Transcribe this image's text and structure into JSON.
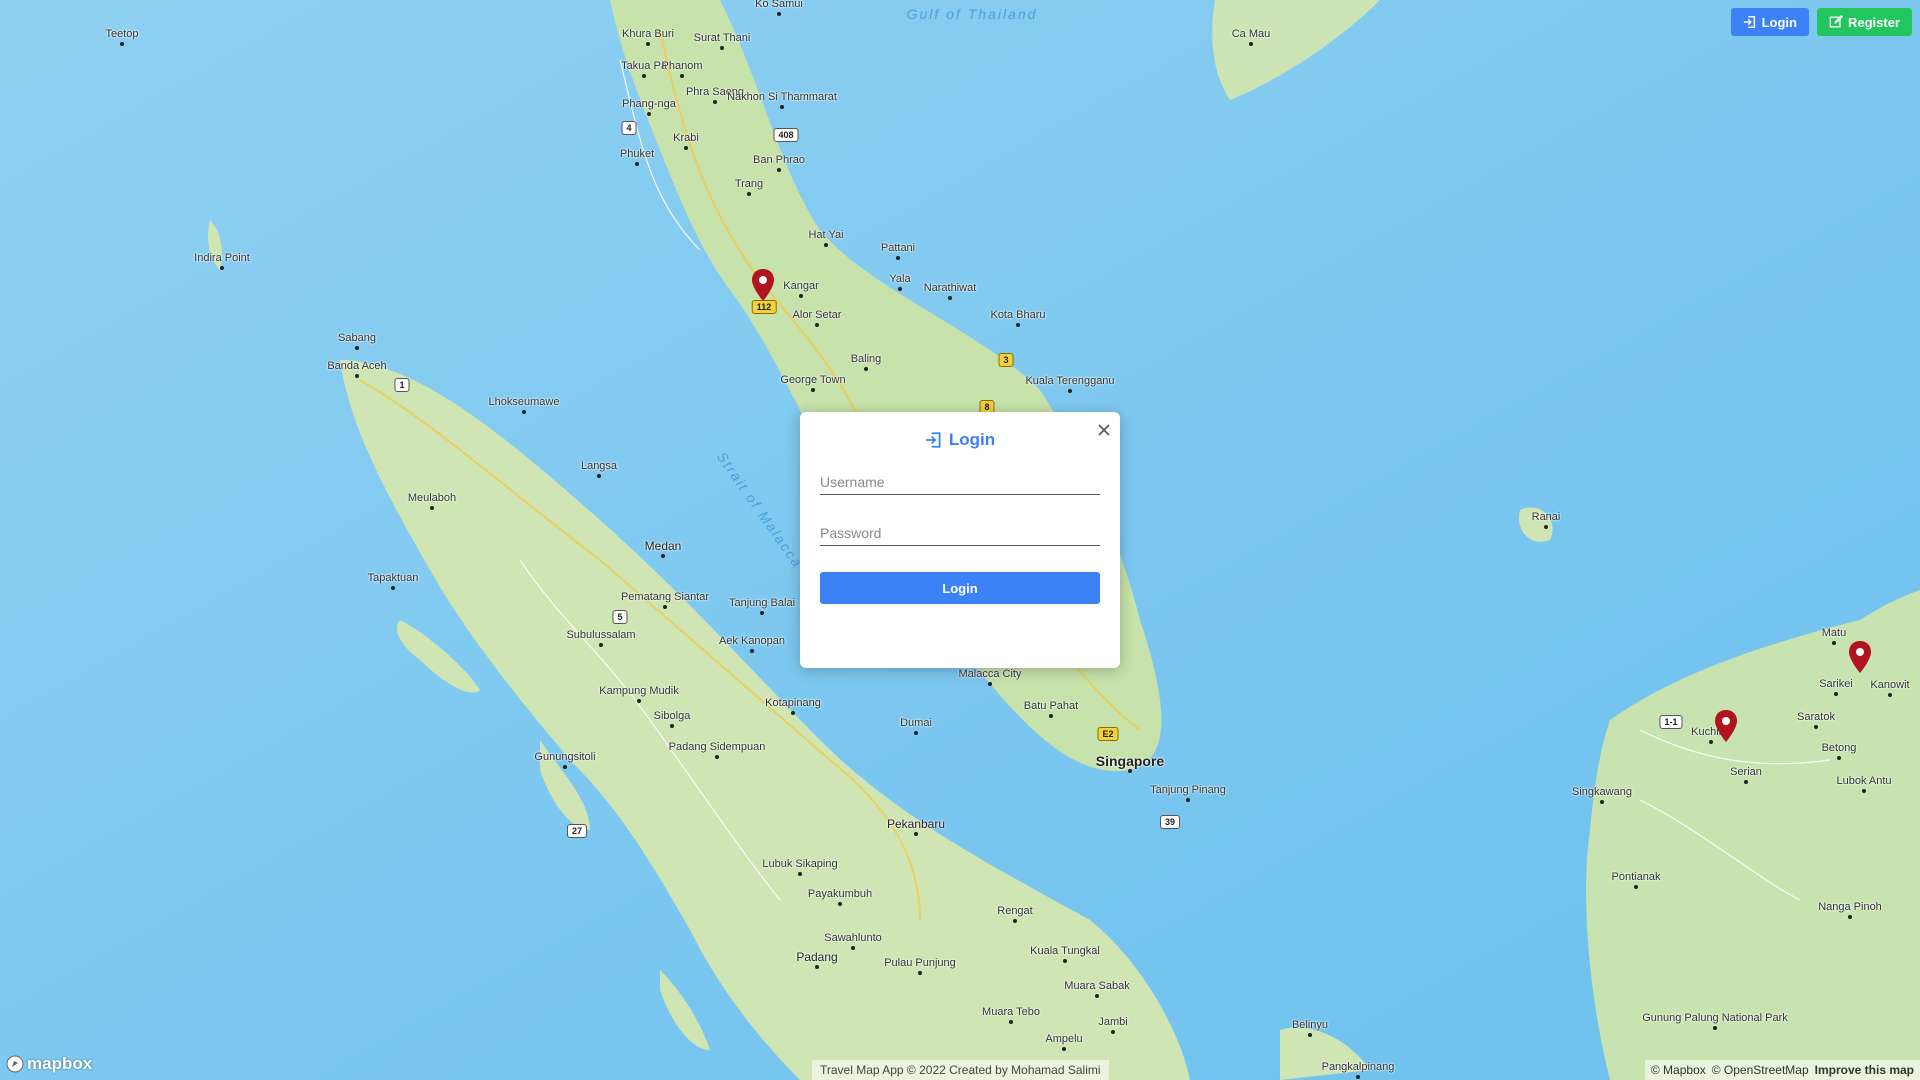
{
  "header": {
    "login_label": "Login",
    "register_label": "Register"
  },
  "modal": {
    "title": "Login",
    "username_placeholder": "Username",
    "password_placeholder": "Password",
    "submit_label": "Login"
  },
  "map": {
    "places": [
      {
        "name": "Teetop",
        "size": "small"
      },
      {
        "name": "Indira Point",
        "size": "small"
      },
      {
        "name": "Sabang",
        "size": "small"
      },
      {
        "name": "Banda Aceh",
        "size": "small"
      },
      {
        "name": "Lhokseumawe",
        "size": "small"
      },
      {
        "name": "Langsa",
        "size": "small"
      },
      {
        "name": "Meulaboh",
        "size": "small"
      },
      {
        "name": "Medan",
        "size": "med"
      },
      {
        "name": "Pematang Siantar",
        "size": "small"
      },
      {
        "name": "Tanjung Balai",
        "size": "small"
      },
      {
        "name": "Tapaktuan",
        "size": "small"
      },
      {
        "name": "Subulussalam",
        "size": "small"
      },
      {
        "name": "Aek Kanopan",
        "size": "small"
      },
      {
        "name": "Kampung Mudik",
        "size": "small"
      },
      {
        "name": "Sibolga",
        "size": "small"
      },
      {
        "name": "Padang Sidempuan",
        "size": "small"
      },
      {
        "name": "Kotapinang",
        "size": "small"
      },
      {
        "name": "Gunungsitoli",
        "size": "small"
      },
      {
        "name": "Lubuk Sikaping",
        "size": "small"
      },
      {
        "name": "Payakumbuh",
        "size": "small"
      },
      {
        "name": "Sawahlunto",
        "size": "small"
      },
      {
        "name": "Padang",
        "size": "med"
      },
      {
        "name": "Pulau Punjung",
        "size": "small"
      },
      {
        "name": "Pekanbaru",
        "size": "med"
      },
      {
        "name": "Dumai",
        "size": "small"
      },
      {
        "name": "Rengat",
        "size": "small"
      },
      {
        "name": "Kuala Tungkal",
        "size": "small"
      },
      {
        "name": "Muara Sabak",
        "size": "small"
      },
      {
        "name": "Muara Tebo",
        "size": "small"
      },
      {
        "name": "Jambi",
        "size": "small"
      },
      {
        "name": "Ampelu",
        "size": "small"
      },
      {
        "name": "Belinyu",
        "size": "small"
      },
      {
        "name": "Pangkalpinang",
        "size": "small"
      },
      {
        "name": "Malacca City",
        "size": "small"
      },
      {
        "name": "Batu Pahat",
        "size": "small"
      },
      {
        "name": "Singapore",
        "size": "big"
      },
      {
        "name": "Tanjung Pinang",
        "size": "small"
      },
      {
        "name": "Khura Buri",
        "size": "small"
      },
      {
        "name": "Surat Thani",
        "size": "small"
      },
      {
        "name": "Takua Pa",
        "size": "small"
      },
      {
        "name": "Phanom",
        "size": "small"
      },
      {
        "name": "Phang-nga",
        "size": "small"
      },
      {
        "name": "Phra Saeng",
        "size": "small"
      },
      {
        "name": "Nakhon Si Thammarat",
        "size": "small"
      },
      {
        "name": "Krabi",
        "size": "small"
      },
      {
        "name": "Phuket",
        "size": "small"
      },
      {
        "name": "Ban Phrao",
        "size": "small"
      },
      {
        "name": "Trang",
        "size": "small"
      },
      {
        "name": "Hat Yai",
        "size": "small"
      },
      {
        "name": "Pattani",
        "size": "small"
      },
      {
        "name": "Yala",
        "size": "small"
      },
      {
        "name": "Narathiwat",
        "size": "small"
      },
      {
        "name": "Kangar",
        "size": "small"
      },
      {
        "name": "Alor Setar",
        "size": "small"
      },
      {
        "name": "Baling",
        "size": "small"
      },
      {
        "name": "Kota Bharu",
        "size": "small"
      },
      {
        "name": "George Town",
        "size": "small"
      },
      {
        "name": "Kuala Terengganu",
        "size": "small"
      },
      {
        "name": "Ko Samui",
        "size": "small"
      },
      {
        "name": "Ca Mau",
        "size": "small"
      },
      {
        "name": "Ranai",
        "size": "small"
      },
      {
        "name": "Matu",
        "size": "small"
      },
      {
        "name": "Sarikei",
        "size": "small"
      },
      {
        "name": "Kanowit",
        "size": "small"
      },
      {
        "name": "Saratok",
        "size": "small"
      },
      {
        "name": "Kuching",
        "size": "small"
      },
      {
        "name": "Betong",
        "size": "small"
      },
      {
        "name": "Serian",
        "size": "small"
      },
      {
        "name": "Lubok Antu",
        "size": "small"
      },
      {
        "name": "Singkawang",
        "size": "small"
      },
      {
        "name": "Pontianak",
        "size": "small"
      },
      {
        "name": "Nanga Pinoh",
        "size": "small"
      },
      {
        "name": "Gunung Palung National Park",
        "size": "small"
      }
    ],
    "sea_labels": [
      "Gulf of Thailand",
      "Strait of Malacca"
    ],
    "road_shields": [
      "112",
      "3",
      "8",
      "E2",
      "39",
      "1",
      "5",
      "27",
      "408",
      "4",
      "1-1"
    ]
  },
  "footer": {
    "credit": "Travel Map App © 2022 Created by Mohamad Salimi",
    "mapbox_logo": "mapbox",
    "attribution_mapbox": "© Mapbox",
    "attribution_osm": "© OpenStreetMap",
    "attribution_improve": "Improve this map"
  }
}
